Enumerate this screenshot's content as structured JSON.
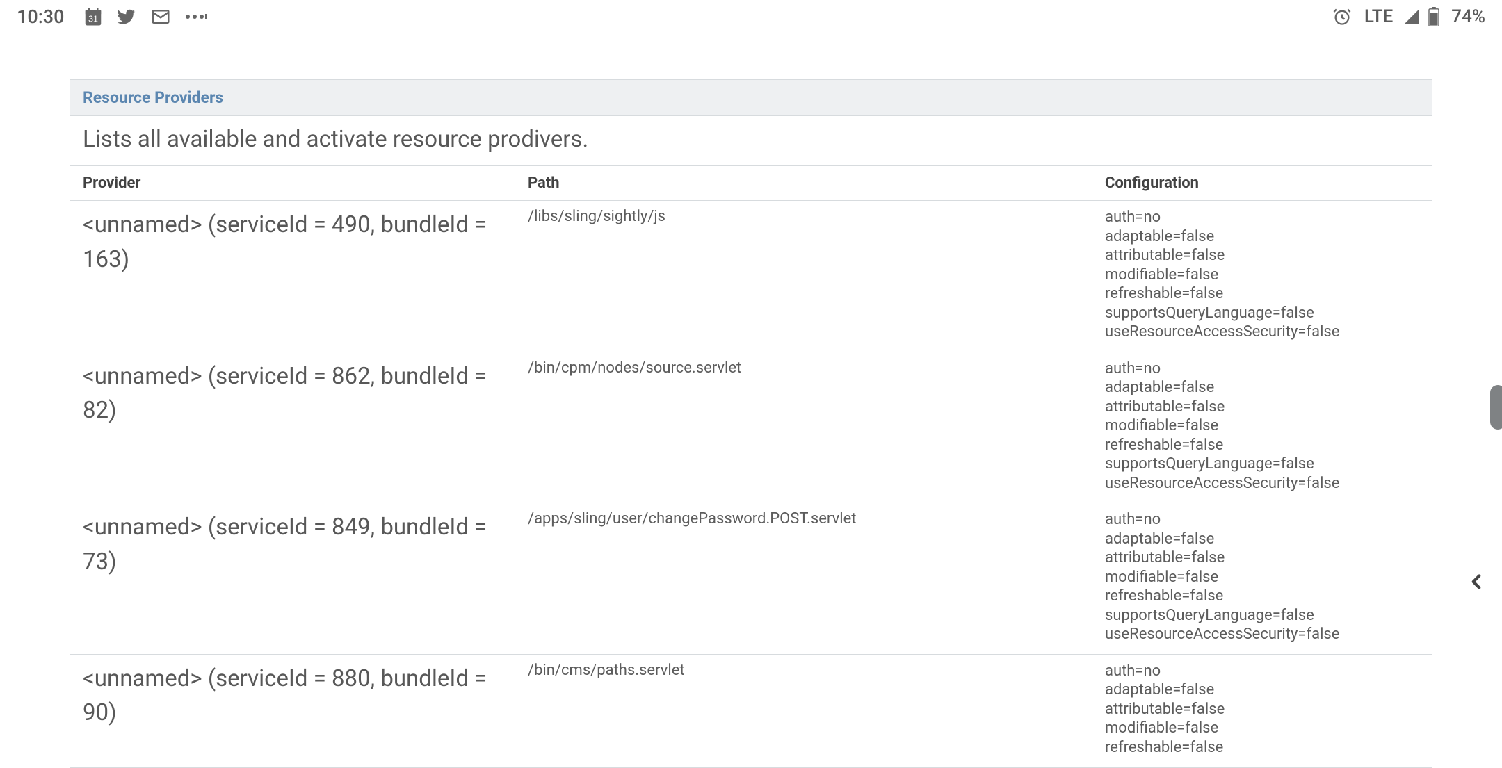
{
  "status": {
    "time": "10:30",
    "lte": "LTE",
    "battery": "74%"
  },
  "panel": {
    "section_title": "Resource Providers",
    "description": "Lists all available and activate resource prodivers."
  },
  "columns": {
    "provider": "Provider",
    "path": "Path",
    "config": "Configuration"
  },
  "config_labels": {
    "auth": "auth",
    "adaptable": "adaptable",
    "attributable": "attributable",
    "modifiable": "modifiable",
    "refreshable": "refreshable",
    "supportsQueryLanguage": "supportsQueryLanguage",
    "useResourceAccessSecurity": "useResourceAccessSecurity"
  },
  "rows": [
    {
      "provider": "<unnamed> (serviceId = 490, bundleId = 163)",
      "path": "/libs/sling/sightly/js",
      "config": {
        "auth": "no",
        "adaptable": "false",
        "attributable": "false",
        "modifiable": "false",
        "refreshable": "false",
        "supportsQueryLanguage": "false",
        "useResourceAccessSecurity": "false"
      }
    },
    {
      "provider": "<unnamed> (serviceId = 862, bundleId = 82)",
      "path": "/bin/cpm/nodes/source.servlet",
      "config": {
        "auth": "no",
        "adaptable": "false",
        "attributable": "false",
        "modifiable": "false",
        "refreshable": "false",
        "supportsQueryLanguage": "false",
        "useResourceAccessSecurity": "false"
      }
    },
    {
      "provider": "<unnamed> (serviceId = 849, bundleId = 73)",
      "path": "/apps/sling/user/changePassword.POST.servlet",
      "config": {
        "auth": "no",
        "adaptable": "false",
        "attributable": "false",
        "modifiable": "false",
        "refreshable": "false",
        "supportsQueryLanguage": "false",
        "useResourceAccessSecurity": "false"
      }
    },
    {
      "provider": "<unnamed> (serviceId = 880, bundleId = 90)",
      "path": "/bin/cms/paths.servlet",
      "config": {
        "auth": "no",
        "adaptable": "false",
        "attributable": "false",
        "modifiable": "false",
        "refreshable": "false"
      }
    }
  ]
}
